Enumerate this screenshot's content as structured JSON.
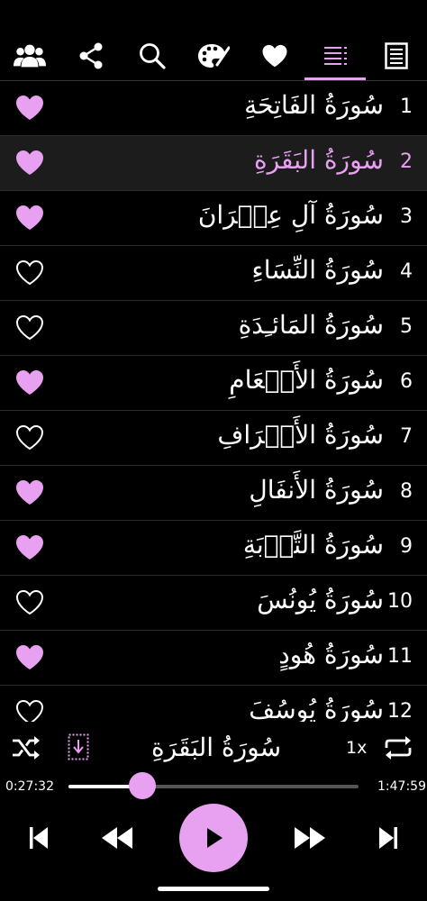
{
  "toolbar": {
    "icons": [
      "group-icon",
      "share-icon",
      "search-icon",
      "palette-icon",
      "heart-icon",
      "list-icon",
      "notes-icon"
    ],
    "active_index": 5
  },
  "colors": {
    "accent": "#e8a0f0",
    "background": "#000000",
    "text": "#ffffff"
  },
  "surahs": [
    {
      "num": "1",
      "name": "سُورَةُ الفَاتِحَةِ",
      "favorite": true,
      "active": false
    },
    {
      "num": "2",
      "name": "سُورَةُ البَقَرَةِ",
      "favorite": true,
      "active": true
    },
    {
      "num": "3",
      "name": "سُورَةُ آلِ عِمۡرَانَ",
      "favorite": true,
      "active": false
    },
    {
      "num": "4",
      "name": "سُورَةُ النِّسَاءِ",
      "favorite": false,
      "active": false
    },
    {
      "num": "5",
      "name": "سُورَةُ المَائـِدَةِ",
      "favorite": false,
      "active": false
    },
    {
      "num": "6",
      "name": "سُورَةُ الأَنۡعَامِ",
      "favorite": true,
      "active": false
    },
    {
      "num": "7",
      "name": "سُورَةُ الأَعۡرَافِ",
      "favorite": false,
      "active": false
    },
    {
      "num": "8",
      "name": "سُورَةُ الأَنفَالِ",
      "favorite": true,
      "active": false
    },
    {
      "num": "9",
      "name": "سُورَةُ التَّوۡبَةِ",
      "favorite": true,
      "active": false
    },
    {
      "num": "10",
      "name": "سُورَةُ يُونُسَ",
      "favorite": false,
      "active": false
    },
    {
      "num": "11",
      "name": "سُورَةُ هُودٍ",
      "favorite": true,
      "active": false
    },
    {
      "num": "12",
      "name": "سُورَةُ يُوسُفَ",
      "favorite": false,
      "active": false
    }
  ],
  "player": {
    "now_playing": "سُورَةُ البَقَرَةِ",
    "speed": "1x",
    "elapsed": "0:27:32",
    "duration": "1:47:59",
    "progress": 0.255
  }
}
